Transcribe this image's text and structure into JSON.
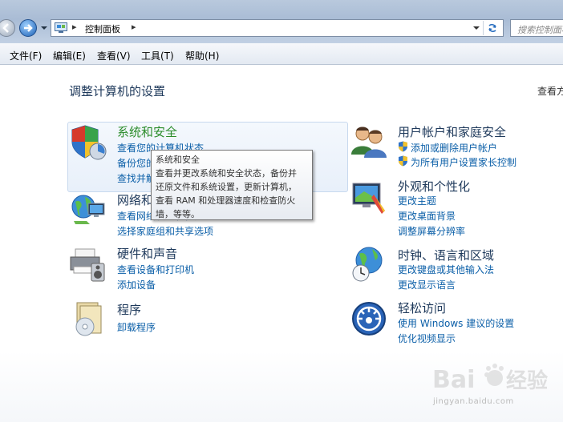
{
  "addressbar": {
    "path": "控制面板",
    "search_placeholder": "搜索控制面板"
  },
  "menubar": {
    "items": [
      "文件(F)",
      "编辑(E)",
      "查看(V)",
      "工具(T)",
      "帮助(H)"
    ]
  },
  "main": {
    "title": "调整计算机的设置",
    "view_by": "查看方式：",
    "categories": {
      "system_security": {
        "title": "系统和安全",
        "links": [
          "查看您的计算机状态",
          "备份您的计算机",
          "查找并解决问题"
        ]
      },
      "network": {
        "title": "网络和 Internet",
        "links": [
          "查看网络状态和任务",
          "选择家庭组和共享选项"
        ]
      },
      "hardware": {
        "title": "硬件和声音",
        "links": [
          "查看设备和打印机",
          "添加设备"
        ]
      },
      "programs": {
        "title": "程序",
        "links": [
          "卸载程序"
        ]
      },
      "users": {
        "title": "用户帐户和家庭安全",
        "links": [
          "添加或删除用户帐户",
          "为所有用户设置家长控制"
        ]
      },
      "appearance": {
        "title": "外观和个性化",
        "links": [
          "更改主题",
          "更改桌面背景",
          "调整屏幕分辨率"
        ]
      },
      "clock": {
        "title": "时钟、语言和区域",
        "links": [
          "更改键盘或其他输入法",
          "更改显示语言"
        ]
      },
      "ease": {
        "title": "轻松访问",
        "links": [
          "使用 Windows 建议的设置",
          "优化视频显示"
        ]
      }
    }
  },
  "tooltip": {
    "lines": [
      "系统和安全",
      "查看并更改系统和安全状态，备份并",
      "还原文件和系统设置，更新计算机，",
      "查看 RAM 和处理器速度和检查防火",
      "墙，等等。"
    ]
  },
  "watermark": {
    "text": "jingyan.baidu.com"
  }
}
